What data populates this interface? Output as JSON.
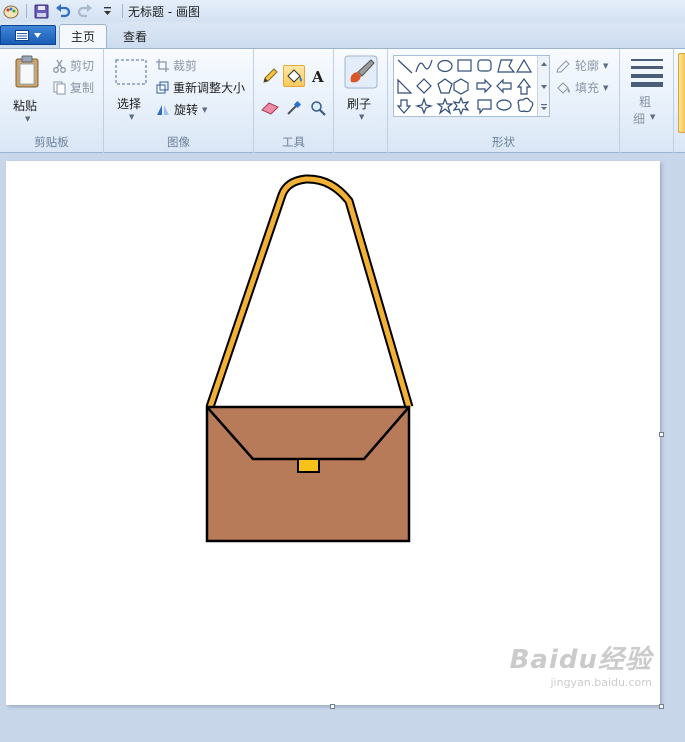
{
  "window": {
    "title": "无标题 - 画图"
  },
  "tabs": [
    {
      "label": "主页",
      "active": true
    },
    {
      "label": "查看",
      "active": false
    }
  ],
  "ribbon": {
    "clipboard": {
      "paste": "粘贴",
      "cut": "剪切",
      "copy": "复制",
      "group_label": "剪贴板"
    },
    "image": {
      "select": "选择",
      "crop": "裁剪",
      "resize": "重新调整大小",
      "rotate": "旋转",
      "group_label": "图像"
    },
    "tools": {
      "group_label": "工具",
      "selected": "fill-bucket"
    },
    "brush": {
      "label": "刷子"
    },
    "shapes": {
      "outline": "轮廓",
      "fill": "填充",
      "group_label": "形状"
    },
    "size": {
      "label_line1": "粗",
      "label_line2": "细"
    }
  },
  "colors": {
    "bag_body": "#b87b59",
    "strap": "#f2b035",
    "clasp": "#f7c21a",
    "outline": "#000000",
    "canvas": "#ffffff",
    "workspace": "#c7d6e9"
  },
  "watermark": {
    "brand": "Baidu经验",
    "url": "jingyan.baidu.com"
  }
}
